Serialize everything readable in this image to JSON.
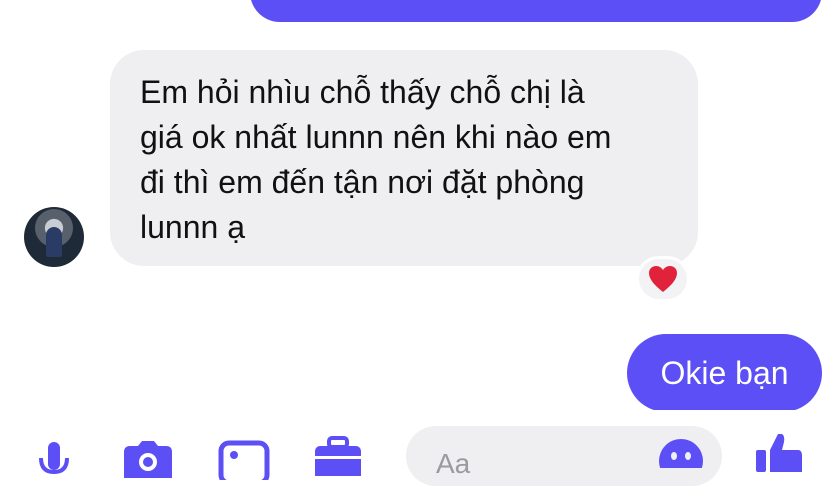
{
  "messages": {
    "outgoing_top": {
      "text": ""
    },
    "incoming": {
      "lines": [
        "Em hỏi nhìu chỗ thấy chỗ chị là",
        "giá ok nhất lunnn nên khi nào em",
        "đi thì em đến tận nơi đặt phòng",
        "lunnn ạ"
      ],
      "reaction": "heart-icon"
    },
    "outgoing_reply": {
      "text": "Okie bạn"
    }
  },
  "composer": {
    "placeholder": "Aa"
  },
  "colors": {
    "outgoing_bubble": "#5b4ff5",
    "incoming_bubble": "#efeff1",
    "accent": "#5b4ff5",
    "reaction_heart": "#e0233a"
  },
  "icons": [
    "mic-icon",
    "camera-icon",
    "gallery-icon",
    "briefcase-icon",
    "emoji-icon",
    "like-icon"
  ]
}
